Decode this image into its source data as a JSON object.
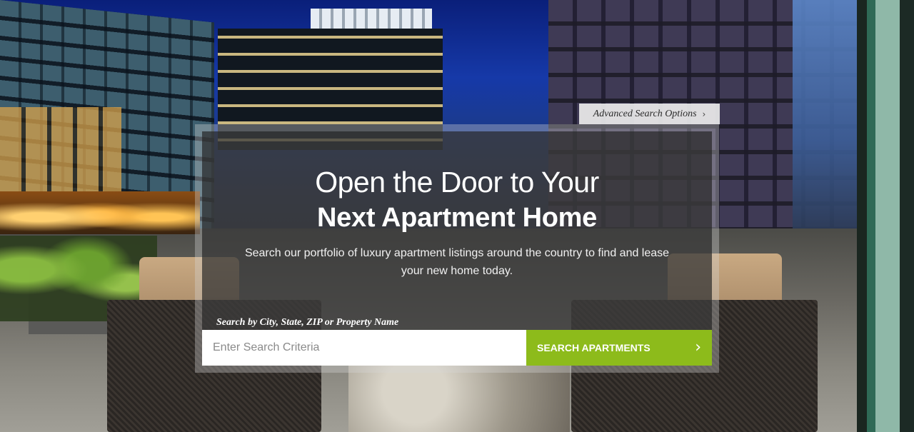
{
  "advanced_search": {
    "label": "Advanced Search Options",
    "icon": "chevron-right-icon"
  },
  "hero": {
    "headline_line1": "Open the Door to Your",
    "headline_line2": "Next Apartment Home",
    "subtitle": "Search our portfolio of luxury apartment listings around the country to find and lease your new home today."
  },
  "search": {
    "caption": "Search by City, State, ZIP or Property Name",
    "input_value": "",
    "placeholder": "Enter Search Criteria",
    "button_label": "SEARCH APARTMENTS",
    "button_icon": "chevron-right-icon"
  },
  "colors": {
    "accent": "#8dbb1b",
    "panel_overlay": "#3c3c3c",
    "tab_background": "#ececec"
  }
}
